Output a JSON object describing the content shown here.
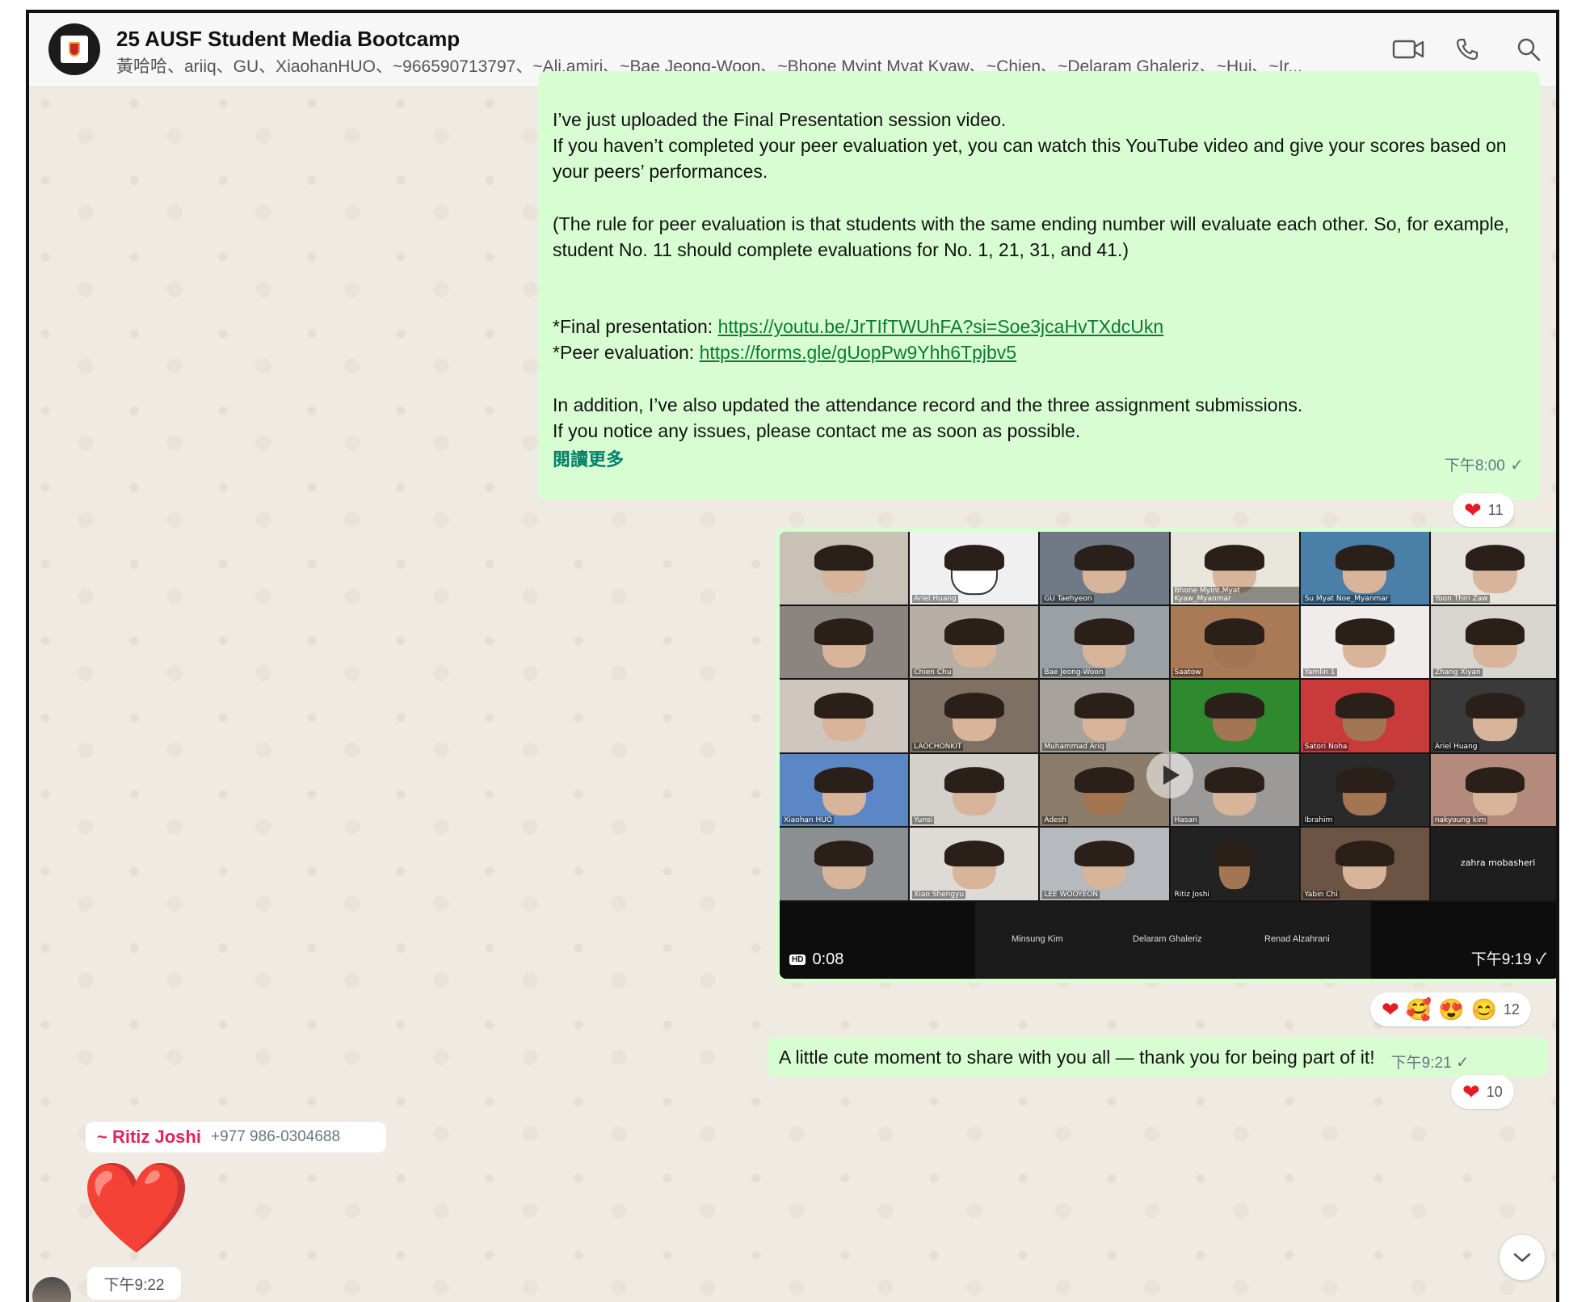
{
  "header": {
    "title": "25 AUSF Student Media Bootcamp",
    "members": "黃哈哈、ariiq、GU、XiaohanHUO、~966590713797、~Ali.amiri、~Bae Jeong-Woon、~Bhone Myint Myat Kyaw、~Chien、~Delaram Ghaleriz、~Hui、~Ir...",
    "icons": [
      "video-call-icon",
      "voice-call-icon",
      "search-icon"
    ]
  },
  "messages": {
    "long": {
      "p1": "I’ve just uploaded the Final Presentation session video.\nIf you haven’t completed your peer evaluation yet, you can watch this YouTube video and give your scores based on your peers’ performances.",
      "p2": "(The rule for peer evaluation is that students with the same ending number will evaluate each other. So, for example, student No. 11 should complete evaluations for No. 1, 21, 31, and 41.)",
      "final_label": "*Final presentation: ",
      "final_link": "https://youtu.be/JrTIfTWUhFA?si=Soe3jcaHvTXdcUkn",
      "peer_label": "*Peer evaluation: ",
      "peer_link": "https://forms.gle/gUopPw9Yhh6Tpjbv5",
      "p4": "In addition, I’ve also updated the attendance record and the three assignment submissions.\nIf you notice any issues, please contact me as soon as possible.",
      "read_more": "閱讀更多",
      "time": "下午8:00",
      "reaction_count": "11"
    },
    "video": {
      "duration": "0:08",
      "hd": "HD",
      "time": "下午9:19",
      "reaction_count": "12",
      "tile_labels": [
        "Ariel Huang",
        "GU Taehyeon",
        "Bhone Myint Myat Kyaw_Myanmar",
        "Su Myat Noe_Myanmar",
        "Yoon Thiri Zaw",
        "Chien Chu",
        "Bae Jeong-Woon",
        "Saatow",
        "Yamlin 1",
        "Zhang Xiyan",
        "LAOCHONKIT",
        "Muhammad Ariq",
        "Satori Noha",
        "Ariel Huang",
        "Xiaohan HUO",
        "Yunsi",
        "Adesh",
        "Hasan",
        "Ibrahim",
        "nakyoung kim",
        "Xiao Shengyu",
        "LEE WOOYEON",
        "Ritiz Joshi",
        "Yabin Chi",
        "zahra mobasheri"
      ],
      "bottom_names": [
        "Minsung Kim",
        "Delaram Ghaleriz",
        "Renad Alzahrani"
      ]
    },
    "short": {
      "text": "A little cute moment to share with you all — thank you for being part of it!",
      "time": "下午9:21",
      "reaction_count": "10"
    },
    "incoming": {
      "sender": "~ Ritiz Joshi",
      "phone": "+977 986-0304688",
      "content": "❤️",
      "time": "下午9:22"
    }
  },
  "colors": {
    "outgoing_bubble": "#d9fdd3",
    "chat_bg": "#efeae2",
    "link": "#0b7a35",
    "sender_name": "#e0245e"
  }
}
